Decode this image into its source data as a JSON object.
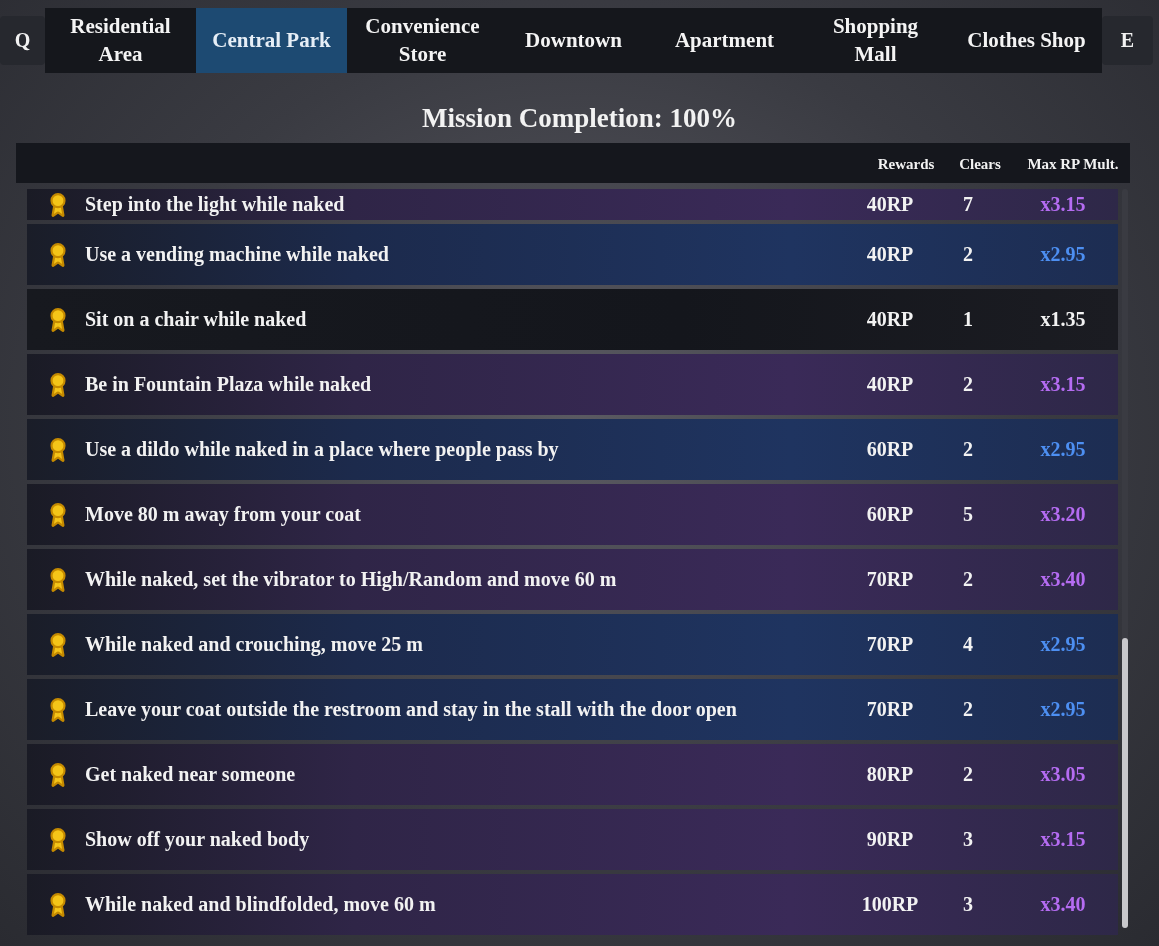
{
  "nav": {
    "prev_key": "Q",
    "next_key": "E",
    "tabs": [
      {
        "label": "Residential Area",
        "selected": false
      },
      {
        "label": "Central Park",
        "selected": true
      },
      {
        "label": "Convenience Store",
        "selected": false
      },
      {
        "label": "Downtown",
        "selected": false
      },
      {
        "label": "Apartment",
        "selected": false
      },
      {
        "label": "Shopping Mall",
        "selected": false
      },
      {
        "label": "Clothes Shop",
        "selected": false
      }
    ]
  },
  "title": "Mission Completion: 100%",
  "table": {
    "columns": [
      "Rewards",
      "Clears",
      "Max RP Mult."
    ],
    "rows": [
      {
        "kind": "purple",
        "mission": "Step into the light while naked",
        "reward": "40RP",
        "clears": "7",
        "mult": "x3.15"
      },
      {
        "kind": "blue",
        "mission": "Use a vending machine while naked",
        "reward": "40RP",
        "clears": "2",
        "mult": "x2.95"
      },
      {
        "kind": "plain",
        "mission": "Sit on a chair while naked",
        "reward": "40RP",
        "clears": "1",
        "mult": "x1.35"
      },
      {
        "kind": "purple",
        "mission": "Be in Fountain Plaza while naked",
        "reward": "40RP",
        "clears": "2",
        "mult": "x3.15"
      },
      {
        "kind": "blue",
        "mission": "Use a dildo while naked in a place where people pass by",
        "reward": "60RP",
        "clears": "2",
        "mult": "x2.95"
      },
      {
        "kind": "purple",
        "mission": "Move 80 m away from your coat",
        "reward": "60RP",
        "clears": "5",
        "mult": "x3.20"
      },
      {
        "kind": "purple",
        "mission": "While naked, set the vibrator to High/Random and move 60 m",
        "reward": "70RP",
        "clears": "2",
        "mult": "x3.40"
      },
      {
        "kind": "blue",
        "mission": "While naked and crouching, move 25 m",
        "reward": "70RP",
        "clears": "4",
        "mult": "x2.95"
      },
      {
        "kind": "blue",
        "mission": "Leave your coat outside the restroom and stay in the stall with the door open",
        "reward": "70RP",
        "clears": "2",
        "mult": "x2.95"
      },
      {
        "kind": "purple",
        "mission": "Get naked near someone",
        "reward": "80RP",
        "clears": "2",
        "mult": "x3.05"
      },
      {
        "kind": "purple",
        "mission": "Show off your naked body",
        "reward": "90RP",
        "clears": "3",
        "mult": "x3.15"
      },
      {
        "kind": "purple",
        "mission": "While naked and blindfolded, move 60 m",
        "reward": "100RP",
        "clears": "3",
        "mult": "x3.40"
      }
    ]
  }
}
